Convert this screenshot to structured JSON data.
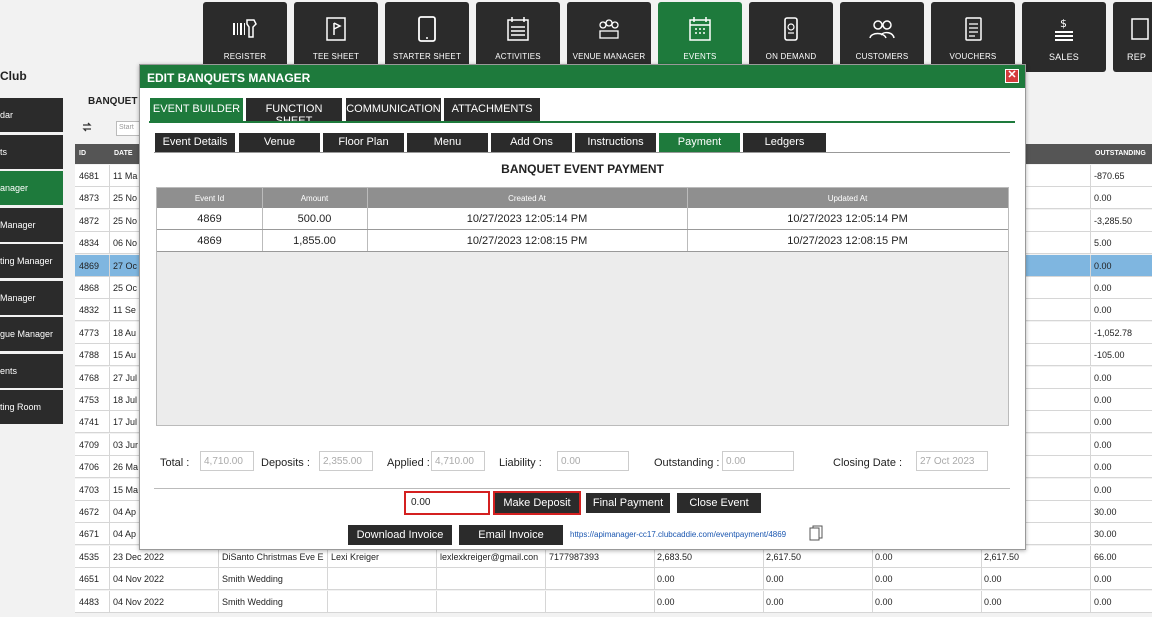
{
  "nav": [
    {
      "label": "REGISTER",
      "icon": "barcode-scanner-icon"
    },
    {
      "label": "TEE SHEET",
      "icon": "flag-sheet-icon"
    },
    {
      "label": "STARTER SHEET",
      "icon": "tablet-icon"
    },
    {
      "label": "ACTIVITIES",
      "icon": "calendar-list-icon"
    },
    {
      "label": "VENUE MANAGER",
      "icon": "people-group-icon"
    },
    {
      "label": "EVENTS",
      "icon": "calendar-grid-icon"
    },
    {
      "label": "ON DEMAND",
      "icon": "mobile-device-icon"
    },
    {
      "label": "CUSTOMERS",
      "icon": "customers-icon"
    },
    {
      "label": "VOUCHERS",
      "icon": "voucher-icon"
    },
    {
      "label": "SALES",
      "icon": "sales-money-icon"
    },
    {
      "label": "REP",
      "icon": "reports-icon"
    }
  ],
  "club_label": "Club",
  "sidebar": [
    {
      "label": "dar"
    },
    {
      "label": "ts"
    },
    {
      "label": "anager"
    },
    {
      "label": "Manager"
    },
    {
      "label": "ting Manager"
    },
    {
      "label": "Manager"
    },
    {
      "label": "gue Manager"
    },
    {
      "label": "ents"
    },
    {
      "label": "ting Room"
    }
  ],
  "background": {
    "title": "BANQUET",
    "search_placeholder": "Start",
    "headers": {
      "id": "ID",
      "date": "DATE",
      "outstanding": "OUTSTANDING"
    },
    "rows": [
      {
        "id": "4681",
        "date": "11 Ma",
        "name": "",
        "contact": "",
        "email": "",
        "phone": "",
        "a": "",
        "b": "",
        "c": "",
        "d": "",
        "out": "-870.65"
      },
      {
        "id": "4873",
        "date": "25 No",
        "name": "",
        "contact": "",
        "email": "",
        "phone": "",
        "a": "",
        "b": "",
        "c": "",
        "d": "",
        "out": "0.00"
      },
      {
        "id": "4872",
        "date": "25 No",
        "name": "",
        "contact": "",
        "email": "",
        "phone": "",
        "a": "",
        "b": "",
        "c": "",
        "d": "",
        "out": "-3,285.50"
      },
      {
        "id": "4834",
        "date": "06 No",
        "name": "",
        "contact": "",
        "email": "",
        "phone": "",
        "a": "",
        "b": "",
        "c": "",
        "d": "",
        "out": "5.00"
      },
      {
        "id": "4869",
        "date": "27 Oc",
        "name": "",
        "contact": "",
        "email": "",
        "phone": "",
        "a": "",
        "b": "",
        "c": "",
        "d": "",
        "out": "0.00",
        "selected": true
      },
      {
        "id": "4868",
        "date": "25 Oc",
        "name": "",
        "contact": "",
        "email": "",
        "phone": "",
        "a": "",
        "b": "",
        "c": "",
        "d": "",
        "out": "0.00"
      },
      {
        "id": "4832",
        "date": "11 Se",
        "name": "",
        "contact": "",
        "email": "",
        "phone": "",
        "a": "",
        "b": "",
        "c": "",
        "d": "",
        "out": "0.00"
      },
      {
        "id": "4773",
        "date": "18 Au",
        "name": "",
        "contact": "",
        "email": "",
        "phone": "",
        "a": "",
        "b": "",
        "c": "",
        "d": "",
        "out": "-1,052.78"
      },
      {
        "id": "4788",
        "date": "15 Au",
        "name": "",
        "contact": "",
        "email": "",
        "phone": "",
        "a": "",
        "b": "",
        "c": "",
        "d": "",
        "out": "-105.00"
      },
      {
        "id": "4768",
        "date": "27 Jul",
        "name": "",
        "contact": "",
        "email": "",
        "phone": "",
        "a": "",
        "b": "",
        "c": "",
        "d": "",
        "out": "0.00"
      },
      {
        "id": "4753",
        "date": "18 Jul",
        "name": "",
        "contact": "",
        "email": "",
        "phone": "",
        "a": "",
        "b": "",
        "c": "",
        "d": "",
        "out": "0.00"
      },
      {
        "id": "4741",
        "date": "17 Jul",
        "name": "",
        "contact": "",
        "email": "",
        "phone": "",
        "a": "",
        "b": "",
        "c": "",
        "d": "",
        "out": "0.00"
      },
      {
        "id": "4709",
        "date": "03 Jur",
        "name": "",
        "contact": "",
        "email": "",
        "phone": "",
        "a": "",
        "b": "",
        "c": "",
        "d": "",
        "out": "0.00"
      },
      {
        "id": "4706",
        "date": "26 Ma",
        "name": "",
        "contact": "",
        "email": "",
        "phone": "",
        "a": "",
        "b": "",
        "c": "",
        "d": "",
        "out": "0.00"
      },
      {
        "id": "4703",
        "date": "15 Ma",
        "name": "",
        "contact": "",
        "email": "",
        "phone": "",
        "a": "",
        "b": "",
        "c": "",
        "d": "",
        "out": "0.00"
      },
      {
        "id": "4672",
        "date": "04 Ap",
        "name": "",
        "contact": "",
        "email": "",
        "phone": "",
        "a": "",
        "b": "",
        "c": "",
        "d": "",
        "out": "30.00"
      },
      {
        "id": "4671",
        "date": "04 Ap",
        "name": "",
        "contact": "",
        "email": "",
        "phone": "",
        "a": "",
        "b": "",
        "c": "",
        "d": "",
        "out": "30.00"
      },
      {
        "id": "4535",
        "date": "23 Dec 2022",
        "name": "DiSanto Christmas Eve E",
        "contact": "Lexi Kreiger",
        "email": "lexlexkreiger@gmail.con",
        "phone": "7177987393",
        "a": "2,683.50",
        "b": "2,617.50",
        "c": "0.00",
        "d": "2,617.50",
        "out": "66.00"
      },
      {
        "id": "4651",
        "date": "04 Nov 2022",
        "name": "Smith Wedding",
        "contact": "",
        "email": "",
        "phone": "",
        "a": "0.00",
        "b": "0.00",
        "c": "0.00",
        "d": "0.00",
        "out": "0.00"
      },
      {
        "id": "4483",
        "date": "04 Nov 2022",
        "name": "Smith Wedding",
        "contact": "",
        "email": "",
        "phone": "",
        "a": "0.00",
        "b": "0.00",
        "c": "0.00",
        "d": "0.00",
        "out": "0.00"
      }
    ]
  },
  "modal": {
    "title": "EDIT BANQUETS MANAGER",
    "close": "✕",
    "main_tabs": [
      "EVENT BUILDER",
      "FUNCTION SHEET",
      "COMMUNICATION",
      "ATTACHMENTS"
    ],
    "sub_tabs": [
      "Event Details",
      "Venue",
      "Floor Plan",
      "Menu",
      "Add Ons",
      "Instructions",
      "Payment",
      "Ledgers"
    ],
    "section_title": "BANQUET EVENT PAYMENT",
    "grid_headers": [
      "Event Id",
      "Amount",
      "Created At",
      "Updated At"
    ],
    "grid_rows": [
      {
        "event_id": "4869",
        "amount": "500.00",
        "created": "10/27/2023 12:05:14 PM",
        "updated": "10/27/2023 12:05:14 PM"
      },
      {
        "event_id": "4869",
        "amount": "1,855.00",
        "created": "10/27/2023 12:08:15 PM",
        "updated": "10/27/2023 12:08:15 PM"
      }
    ],
    "summary": {
      "total_label": "Total :",
      "total": "4,710.00",
      "deposits_label": "Deposits :",
      "deposits": "2,355.00",
      "applied_label": "Applied :",
      "applied": "4,710.00",
      "liability_label": "Liability :",
      "liability": "0.00",
      "outstanding_label": "Outstanding :",
      "outstanding": "0.00",
      "closing_label": "Closing Date :",
      "closing": "27 Oct 2023"
    },
    "deposit_value": "0.00",
    "buttons": {
      "make_deposit": "Make Deposit",
      "final_payment": "Final Payment",
      "close_event": "Close Event",
      "download_invoice": "Download Invoice",
      "email_invoice": "Email Invoice"
    },
    "payment_link": "https://apimanager-cc17.clubcaddie.com/eventpayment/4869"
  },
  "colors": {
    "accent_green": "#1e7a3c",
    "dark": "#2b2b2b",
    "highlight_red": "#d42020",
    "selected_row": "#7fb6e0"
  }
}
